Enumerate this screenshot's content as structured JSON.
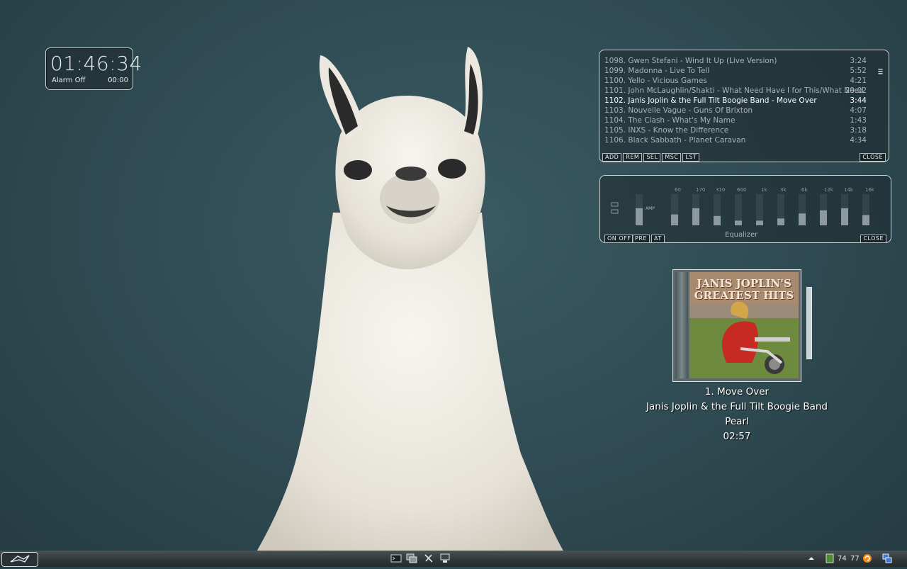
{
  "clock": {
    "time": "01:46:34",
    "alarm_label": "Alarm Off",
    "alarm_time": "00:00"
  },
  "playlist": {
    "rows": [
      {
        "title": "1098. Gwen Stefani - Wind It Up (Live Version)",
        "duration": "3:24",
        "active": false
      },
      {
        "title": "1099. Madonna - Live To Tell",
        "duration": "5:52",
        "active": false
      },
      {
        "title": "1100. Yello - Vicious Games",
        "duration": "4:21",
        "active": false
      },
      {
        "title": "1101. John McLaughlin/Shakti - What Need Have I for This/What Need ...",
        "duration": "29:02",
        "active": false
      },
      {
        "title": "1102. Janis Joplin & the Full Tilt Boogie Band - Move Over",
        "duration": "3:44",
        "active": true
      },
      {
        "title": "1103. Nouvelle Vague - Guns Of Brixton",
        "duration": "4:07",
        "active": false
      },
      {
        "title": "1104. The Clash - What's My Name",
        "duration": "1:43",
        "active": false
      },
      {
        "title": "1105. INXS - Know the Difference",
        "duration": "3:18",
        "active": false
      },
      {
        "title": "1106. Black Sabbath - Planet Caravan",
        "duration": "4:34",
        "active": false
      }
    ],
    "buttons": {
      "add": "ADD",
      "rem": "REM",
      "sel": "SEL",
      "msc": "MSC",
      "lst": "LST",
      "close": "CLOSE"
    }
  },
  "equalizer": {
    "title": "Equalizer",
    "amp_label": "AMP",
    "buttons": {
      "onoff": "ON OFF",
      "pre": "PRE",
      "at": "AT",
      "close": "CLOSE"
    },
    "frequencies": [
      "60",
      "170",
      "310",
      "600",
      "1k",
      "3k",
      "6k",
      "12k",
      "14k",
      "16k"
    ],
    "preamp_level": 0.55,
    "band_levels": [
      0.35,
      0.55,
      0.3,
      0.15,
      0.15,
      0.22,
      0.38,
      0.48,
      0.55,
      0.33
    ]
  },
  "now_playing": {
    "cover_line1": "JANIS JOPLIN'S",
    "cover_line2": "GREATEST HITS",
    "track": "1. Move Over",
    "artist": "Janis Joplin & the Full Tilt Boogie Band",
    "album": "Pearl",
    "elapsed": "02:57"
  },
  "taskbar": {
    "tray_value_1": "74",
    "tray_value_2": "77"
  }
}
